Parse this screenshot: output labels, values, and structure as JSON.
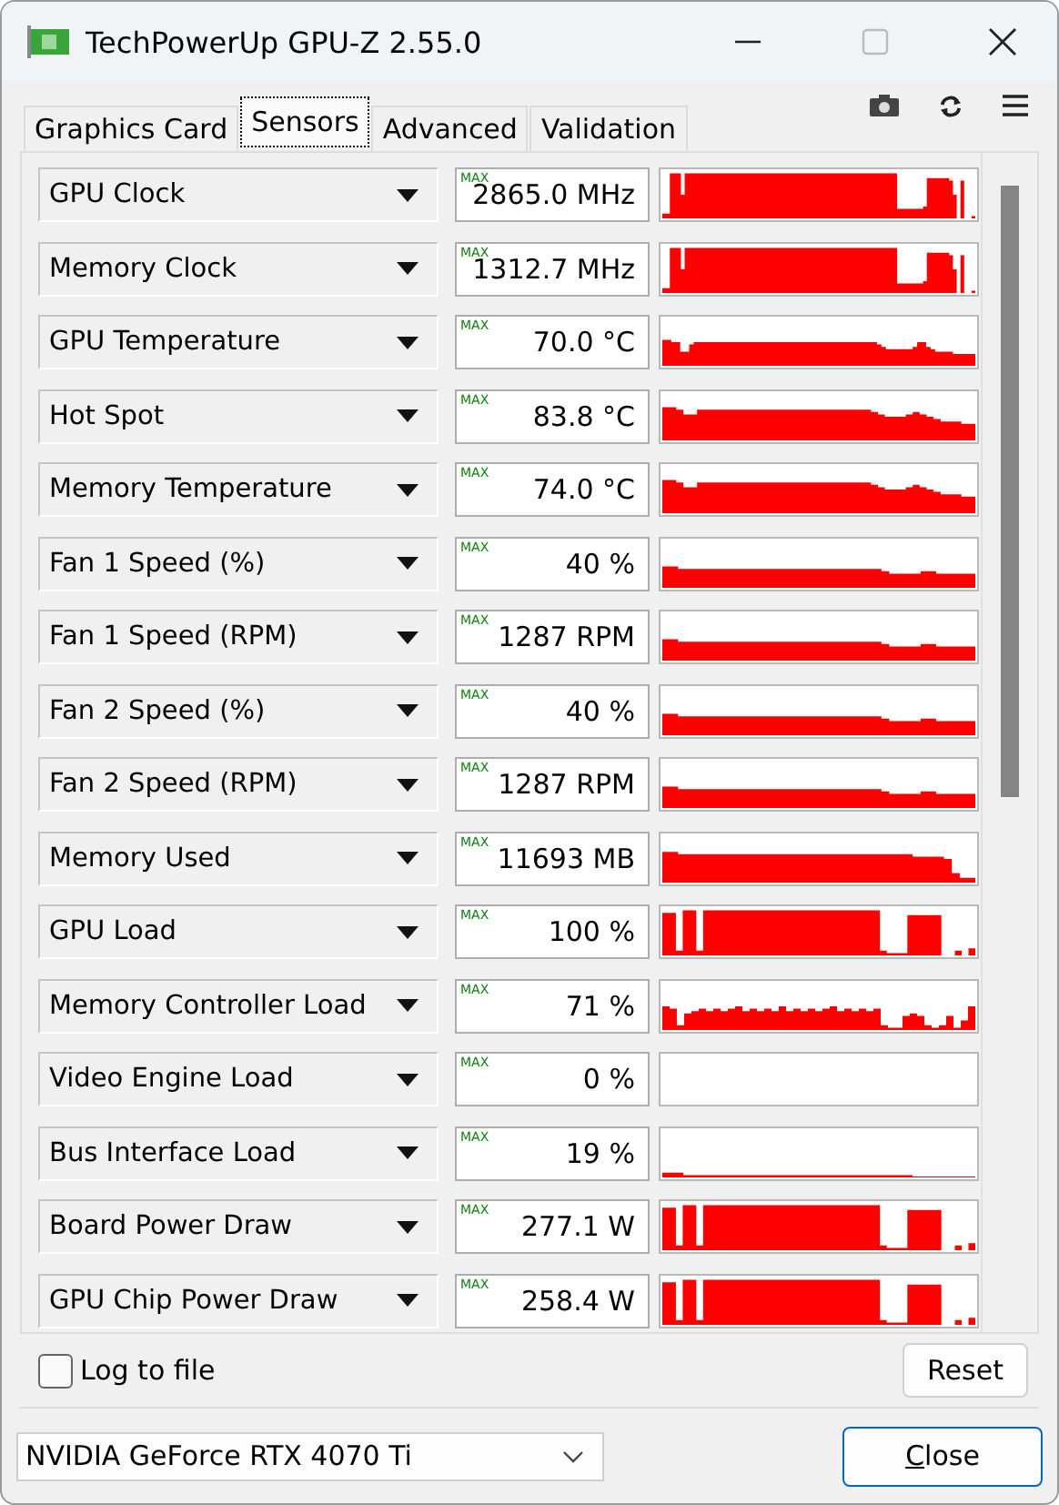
{
  "window": {
    "title": "TechPowerUp GPU-Z 2.55.0"
  },
  "tabs": [
    {
      "label": "Graphics Card",
      "selected": false
    },
    {
      "label": "Sensors",
      "selected": true
    },
    {
      "label": "Advanced",
      "selected": false
    },
    {
      "label": "Validation",
      "selected": false
    }
  ],
  "sensors": [
    {
      "name": "GPU Clock",
      "tag": "MAX",
      "reading": "2865.0 MHz"
    },
    {
      "name": "Memory Clock",
      "tag": "MAX",
      "reading": "1312.7 MHz"
    },
    {
      "name": "GPU Temperature",
      "tag": "MAX",
      "reading": "70.0 °C"
    },
    {
      "name": "Hot Spot",
      "tag": "MAX",
      "reading": "83.8 °C"
    },
    {
      "name": "Memory Temperature",
      "tag": "MAX",
      "reading": "74.0 °C"
    },
    {
      "name": "Fan 1 Speed (%)",
      "tag": "MAX",
      "reading": "40 %"
    },
    {
      "name": "Fan 1 Speed (RPM)",
      "tag": "MAX",
      "reading": "1287 RPM"
    },
    {
      "name": "Fan 2 Speed (%)",
      "tag": "MAX",
      "reading": "40 %"
    },
    {
      "name": "Fan 2 Speed (RPM)",
      "tag": "MAX",
      "reading": "1287 RPM"
    },
    {
      "name": "Memory Used",
      "tag": "MAX",
      "reading": "11693 MB"
    },
    {
      "name": "GPU Load",
      "tag": "MAX",
      "reading": "100 %"
    },
    {
      "name": "Memory Controller Load",
      "tag": "MAX",
      "reading": "71 %"
    },
    {
      "name": "Video Engine Load",
      "tag": "MAX",
      "reading": "0 %"
    },
    {
      "name": "Bus Interface Load",
      "tag": "MAX",
      "reading": "19 %"
    },
    {
      "name": "Board Power Draw",
      "tag": "MAX",
      "reading": "277.1 W"
    },
    {
      "name": "GPU Chip Power Draw",
      "tag": "MAX",
      "reading": "258.4 W"
    }
  ],
  "log_to_file": {
    "label": "Log to file",
    "checked": false
  },
  "reset_button": "Reset",
  "gpu_select": {
    "value": "NVIDIA GeForce RTX 4070 Ti"
  },
  "close_button": "Close"
}
